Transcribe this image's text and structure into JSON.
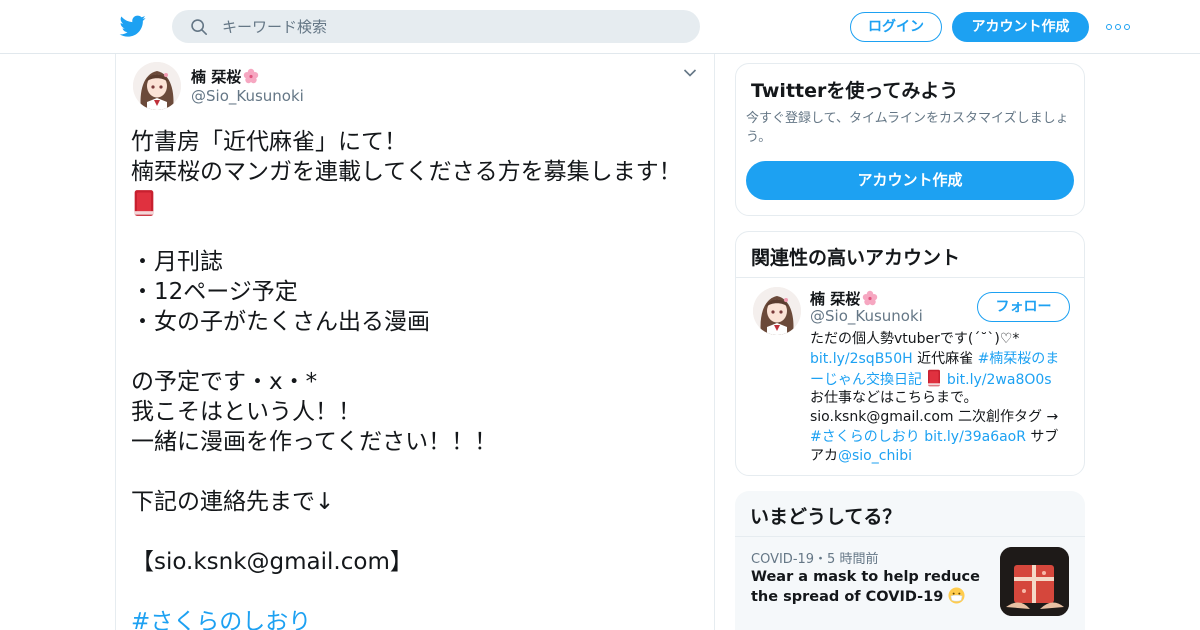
{
  "topbar": {
    "search_placeholder": "キーワード検索",
    "login_label": "ログイン",
    "signup_label": "アカウント作成"
  },
  "tweet": {
    "display_name": "楠 栞桜",
    "handle": "@Sio_Kusunoki",
    "lines": [
      "竹書房「近代麻雀」にて！",
      "楠栞桜のマンガを連載してくださる方を募集します！",
      "",
      "",
      "・月刊誌",
      "・12ページ予定",
      "・女の子がたくさん出る漫画",
      "",
      "の予定です・x・*",
      "我こそはという人！！",
      "一緒に漫画を作ってください！！！",
      "",
      "下記の連絡先まで↓",
      "",
      "【sio.ksnk@gmail.com】",
      "",
      "#さくらのしおり"
    ]
  },
  "signup_card": {
    "title": "Twitterを使ってみよう",
    "description": "今すぐ登録して、タイムラインをカスタマイズしましょう。",
    "button_label": "アカウント作成"
  },
  "related_card": {
    "title": "関連性の高いアカウント",
    "name": "楠 栞桜",
    "handle": "@Sio_Kusunoki",
    "follow_label": "フォロー",
    "bio": {
      "l1": "ただの個人勢vtuberです(´˘`)♡*",
      "l2_link1": "bit.ly/2sqB50H",
      "l2_text": " 近代麻雀 ",
      "l2_hash": "#楠栞桜のま",
      "l3_hash": "ーじゃん交換日記",
      "l3_link": "bit.ly/2wa8O0s",
      "l4": "お仕事などはこちらまで。",
      "l5": "sio.ksnk@gmail.com 二次創作タグ →",
      "l6_hash": "#さくらのしおり",
      "l6_link": "bit.ly/39a6aoR",
      "l6_text": " サブ",
      "l7_text": "アカ",
      "l7_mention": "@sio_chibi"
    }
  },
  "trends": {
    "title": "いまどうしてる？",
    "meta": "COVID-19・5 時間前",
    "headline": "Wear a mask to help reduce the spread of COVID-19"
  },
  "colors": {
    "accent": "#1da1f2",
    "text": "#14171a",
    "muted": "#657786",
    "border": "#e6ecf0"
  }
}
